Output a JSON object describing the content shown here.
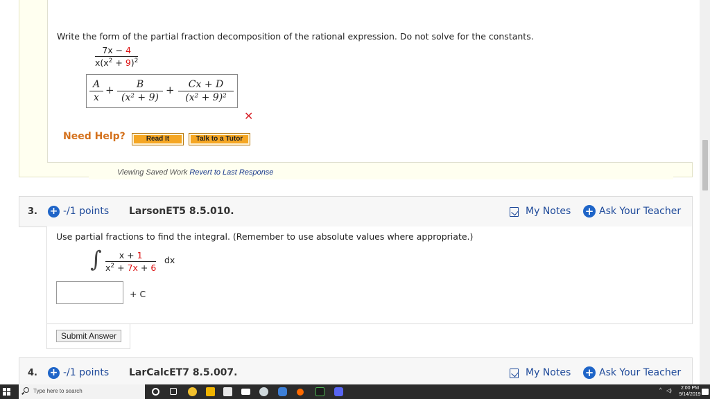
{
  "q2": {
    "prompt": "Write the form of the partial fraction decomposition of the rational expression. Do not solve for the constants.",
    "expr_num_a": "7x − ",
    "expr_num_b": "4",
    "expr_den_a": "x(x",
    "expr_den_sup": "2",
    "expr_den_b": " + ",
    "expr_den_c": "9",
    "expr_den_d": ")",
    "expr_den_sup2": "2",
    "answer": {
      "t1_num": "A",
      "t1_den": "x",
      "t2_num": "B",
      "t2_den": "(x² + 9)",
      "t3_num": "Cx + D",
      "t3_den": "(x² + 9)²",
      "plus": "+"
    },
    "wrong_mark": "✕",
    "need_help": "Need Help?",
    "read_it": "Read It",
    "talk_to_tutor": "Talk to a Tutor",
    "viewing_saved": "Viewing Saved Work ",
    "revert": "Revert to Last Response"
  },
  "q3": {
    "number": "3.",
    "points": "-/1 points",
    "id": "LarsonET5 8.5.010.",
    "my_notes": "My Notes",
    "ask_teacher": "Ask Your Teacher",
    "prompt": "Use partial fractions to find the integral. (Remember to use absolute values where appropriate.)",
    "integral_sign": "∫",
    "num_a": "x + ",
    "num_b": "1",
    "den_a": "x",
    "den_sup": "2",
    "den_b": " + ",
    "den_c": "7x",
    "den_d": " + ",
    "den_e": "6",
    "dx": "dx",
    "answer_value": "",
    "plus_c": "+ C",
    "submit": "Submit Answer"
  },
  "q4": {
    "number": "4.",
    "points": "-/1 points",
    "id": "LarCalcET7 8.5.007.",
    "my_notes": "My Notes",
    "ask_teacher": "Ask Your Teacher"
  },
  "taskbar": {
    "search_placeholder": "Type here to search",
    "time": "2:00 PM",
    "date": "9/14/2019",
    "tray_arrow": "^",
    "tray_volume": "◁)"
  },
  "colors": {
    "link_blue": "#1f4a9a",
    "accent_blue": "#1f65c8",
    "error_red": "#d8232a",
    "help_orange": "#d4711c",
    "button_orange": "#f5a623"
  }
}
